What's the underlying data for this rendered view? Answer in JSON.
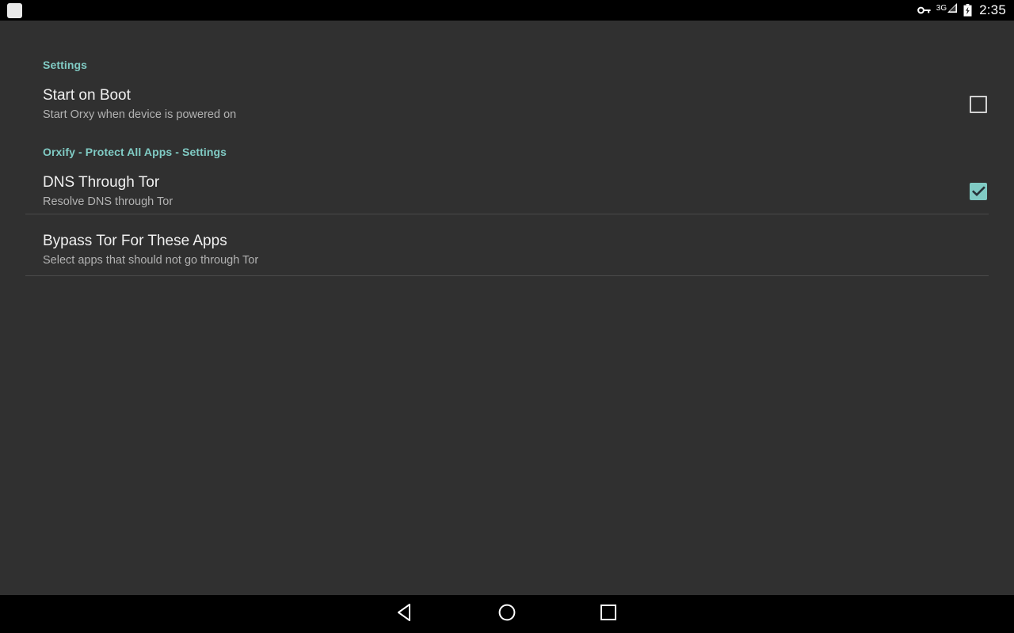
{
  "status_bar": {
    "notification_icon": "app-notification-icon",
    "vpn_icon": "key-icon",
    "network_type": "3G",
    "signal_icon": "signal-bars-icon",
    "battery_icon": "battery-charging-icon",
    "time": "2:35"
  },
  "sections": [
    {
      "header": "Settings",
      "items": [
        {
          "title": "Start on Boot",
          "summary": "Start Orxy when device is powered on",
          "control": "checkbox",
          "checked": false
        }
      ]
    },
    {
      "header": "Orxify - Protect All Apps - Settings",
      "items": [
        {
          "title": "DNS Through Tor",
          "summary": "Resolve DNS through Tor",
          "control": "checkbox",
          "checked": true
        },
        {
          "title": "Bypass Tor For These Apps",
          "summary": "Select apps that should not go through Tor",
          "control": "none",
          "checked": false
        }
      ]
    }
  ],
  "nav_bar": {
    "back": "back-triangle-icon",
    "home": "home-circle-icon",
    "recents": "recents-square-icon"
  },
  "colors": {
    "background": "#303030",
    "accent_teal": "#80cbc4",
    "title_text": "#f0f0f0",
    "summary_text": "#b2b2b2",
    "divider": "#4a4a4a",
    "system_bar": "#000000"
  }
}
